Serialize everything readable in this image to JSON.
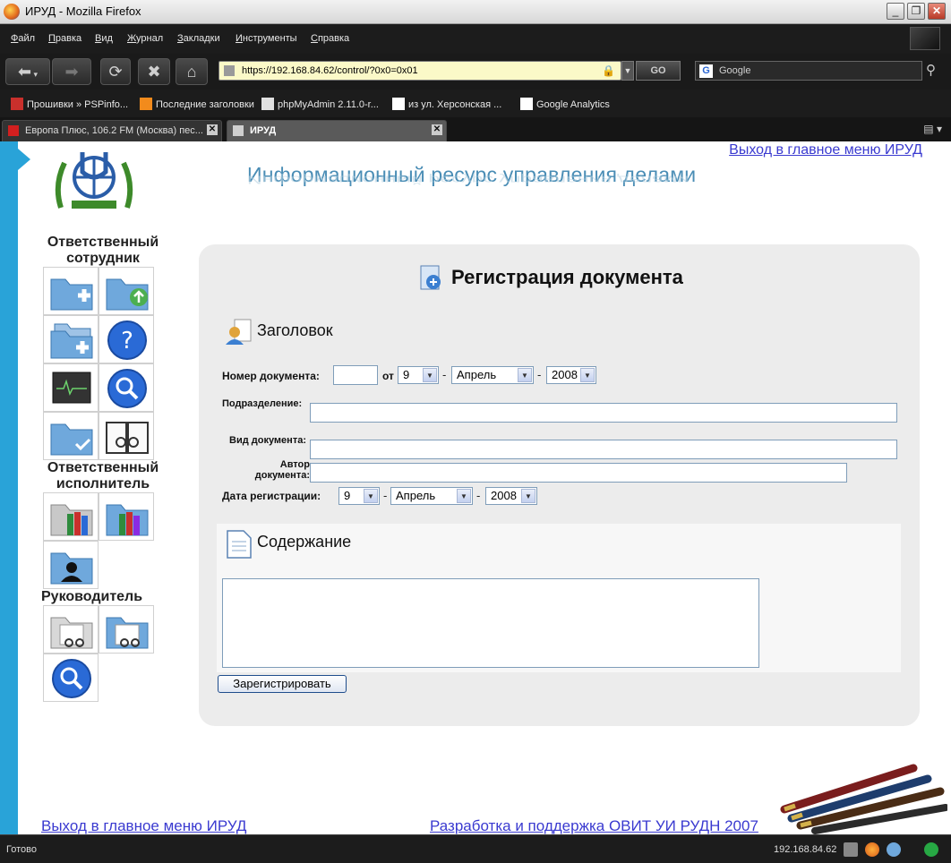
{
  "window": {
    "title": "ИРУД - Mozilla Firefox"
  },
  "menubar": {
    "items": [
      "Файл",
      "Правка",
      "Вид",
      "Журнал",
      "Закладки",
      "Инструменты",
      "Справка"
    ]
  },
  "navbar": {
    "url": "https://192.168.84.62/control/?0x0=0x01",
    "go_label": "GO",
    "search_placeholder": "Google"
  },
  "bookmarks": [
    {
      "label": "Прошивки » PSPinfo...",
      "icon": "playstation-icon"
    },
    {
      "label": "Последние заголовки",
      "icon": "rss-feed-icon"
    },
    {
      "label": "phpMyAdmin 2.11.0-r...",
      "icon": "page-icon"
    },
    {
      "label": "из ул. Херсонская  ...",
      "icon": "google-icon"
    },
    {
      "label": "Google Analytics",
      "icon": "google-icon"
    }
  ],
  "tabs": [
    {
      "label": "Европа Плюс, 106.2 FM (Москва) пес...",
      "active": false
    },
    {
      "label": "ИРУД",
      "active": true
    }
  ],
  "page": {
    "exit_link_top": "Выход в главное меню ИРУД",
    "banner_title": "Информационный ресурс управления делами",
    "sidebar": {
      "heading_1": "Ответственный сотрудник",
      "heading_2": "Ответственный исполнитель",
      "heading_3": "Руководитель"
    },
    "form": {
      "title": "Регистрация документа",
      "section_header": "Заголовок",
      "doc_number_label": "Номер документа:",
      "doc_number_value": "",
      "from_label": "от",
      "date_day": "9",
      "date_month": "Апрель",
      "date_year": "2008",
      "dash": "-",
      "division_label": "Подразделение:",
      "division_value": "",
      "doc_type_label": "Вид документа:",
      "doc_type_value": "",
      "author_label_1": "Автор",
      "author_label_2": "документа:",
      "author_value": "",
      "reg_date_label": "Дата регистрации:",
      "reg_day": "9",
      "reg_month": "Апрель",
      "reg_year": "2008",
      "content_header": "Содержание",
      "content_value": "",
      "submit_label": "Зарегистрировать"
    },
    "footer": {
      "exit_link": "Выход в главное меню ИРУД",
      "credits": "Разработка и поддержка ОВИТ УИ РУДН 2007"
    }
  },
  "statusbar": {
    "status": "Готово",
    "ip": "192.168.84.62"
  }
}
